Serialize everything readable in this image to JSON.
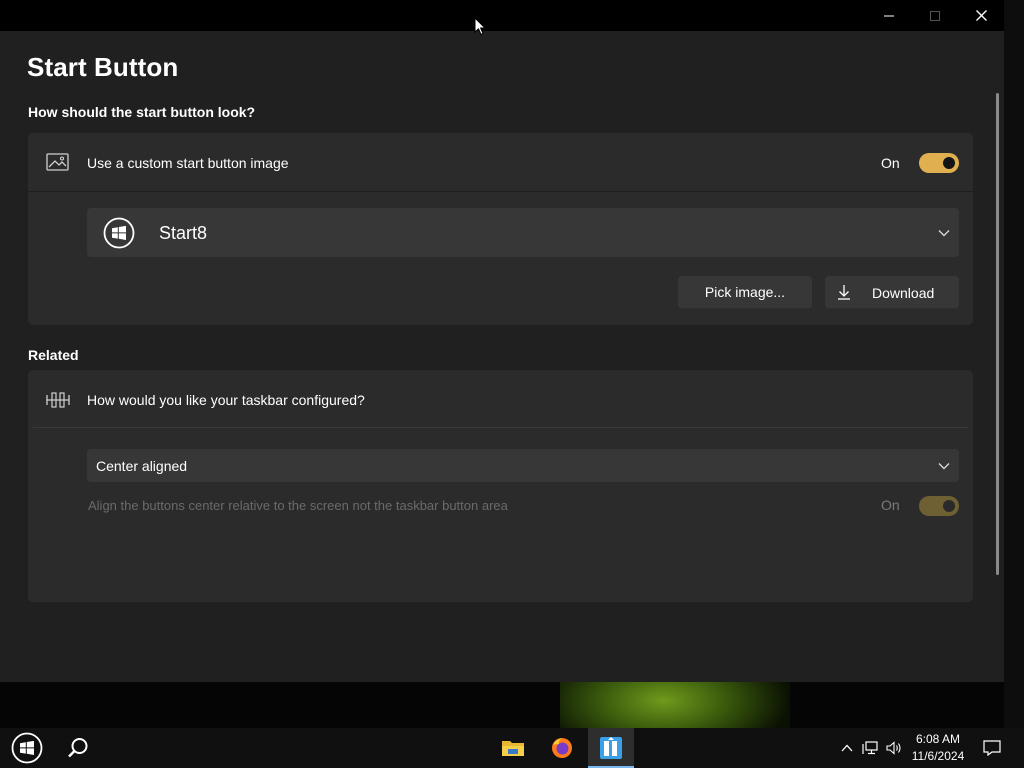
{
  "page": {
    "title": "Start Button"
  },
  "section_start": {
    "header": "How should the start button look?",
    "custom_image_row": {
      "icon": "image-icon",
      "label": "Use a custom start button image",
      "toggle_state": "On",
      "toggle_on": true
    },
    "image_select": {
      "icon": "windows-logo-icon",
      "value": "Start8"
    },
    "pick_button": "Pick image...",
    "download_button": "Download"
  },
  "section_related": {
    "header": "Related",
    "taskbar_row": {
      "icon": "taskbar-layout-icon",
      "label": "How would you like your taskbar configured?"
    },
    "alignment_select": {
      "value": "Center aligned"
    },
    "align_screen_row": {
      "label": "Align the buttons center relative to the screen not the taskbar button area",
      "toggle_state": "On",
      "toggle_on": true,
      "disabled": true
    }
  },
  "taskbar": {
    "pinned": [
      "file-explorer-icon",
      "firefox-icon",
      "app-icon"
    ],
    "clock_time": "6:08 AM",
    "clock_date": "11/6/2024"
  },
  "colors": {
    "accent": "#e0b050",
    "window_bg": "#202020",
    "card_bg": "#2b2b2b",
    "control_bg": "#373737"
  }
}
